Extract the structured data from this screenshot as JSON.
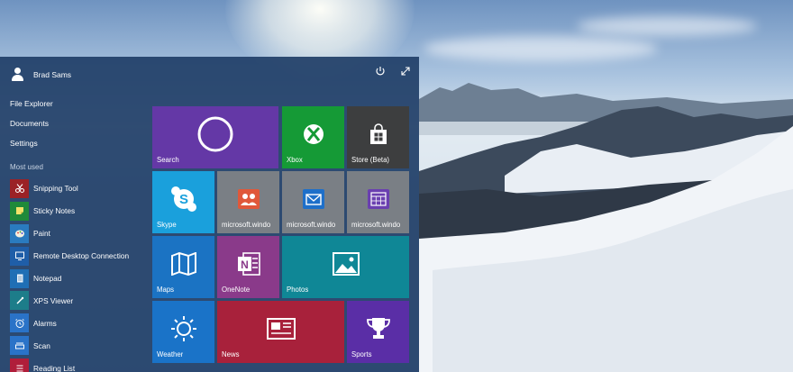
{
  "colors": {
    "search": "#6438a6",
    "xbox": "#159a36",
    "store": "#3d3e3f",
    "skype": "#1aa0dc",
    "gray_tile": "#7a7f85",
    "onenote": "#8a3a8a",
    "photos": "#0f8796",
    "maps": "#1b73c3",
    "weather": "#1a73c8",
    "news": "#a8213b",
    "sports": "#5a2ea6"
  },
  "start_menu": {
    "user_name": "Brad Sams",
    "power_icon": "power-icon",
    "expand_icon": "expand-icon",
    "links": [
      "File Explorer",
      "Documents",
      "Settings"
    ],
    "most_used_header": "Most used",
    "apps": [
      {
        "label": "Snipping Tool",
        "icon": "scissors-icon",
        "color": "#9b2226"
      },
      {
        "label": "Sticky Notes",
        "icon": "sticky-note-icon",
        "color": "#1f8a3a"
      },
      {
        "label": "Paint",
        "icon": "palette-icon",
        "color": "#2a7bbf"
      },
      {
        "label": "Remote Desktop Connection",
        "icon": "monitor-icon",
        "color": "#1f5ea8"
      },
      {
        "label": "Notepad",
        "icon": "notepad-icon",
        "color": "#1f6fb5"
      },
      {
        "label": "XPS Viewer",
        "icon": "xps-icon",
        "color": "#1d7d8a"
      },
      {
        "label": "Alarms",
        "icon": "alarm-icon",
        "color": "#2a73c8"
      },
      {
        "label": "Scan",
        "icon": "scan-icon",
        "color": "#2a73c8"
      },
      {
        "label": "Reading List",
        "icon": "reading-list-icon",
        "color": "#b01e3a"
      }
    ]
  },
  "tiles": {
    "search": "Search",
    "xbox": "Xbox",
    "store": "Store (Beta)",
    "skype": "Skype",
    "people": "microsoft.windo",
    "mail": "microsoft.windo",
    "calendar": "microsoft.windo",
    "maps": "Maps",
    "onenote": "OneNote",
    "photos": "Photos",
    "weather": "Weather",
    "news": "News",
    "sports": "Sports"
  }
}
